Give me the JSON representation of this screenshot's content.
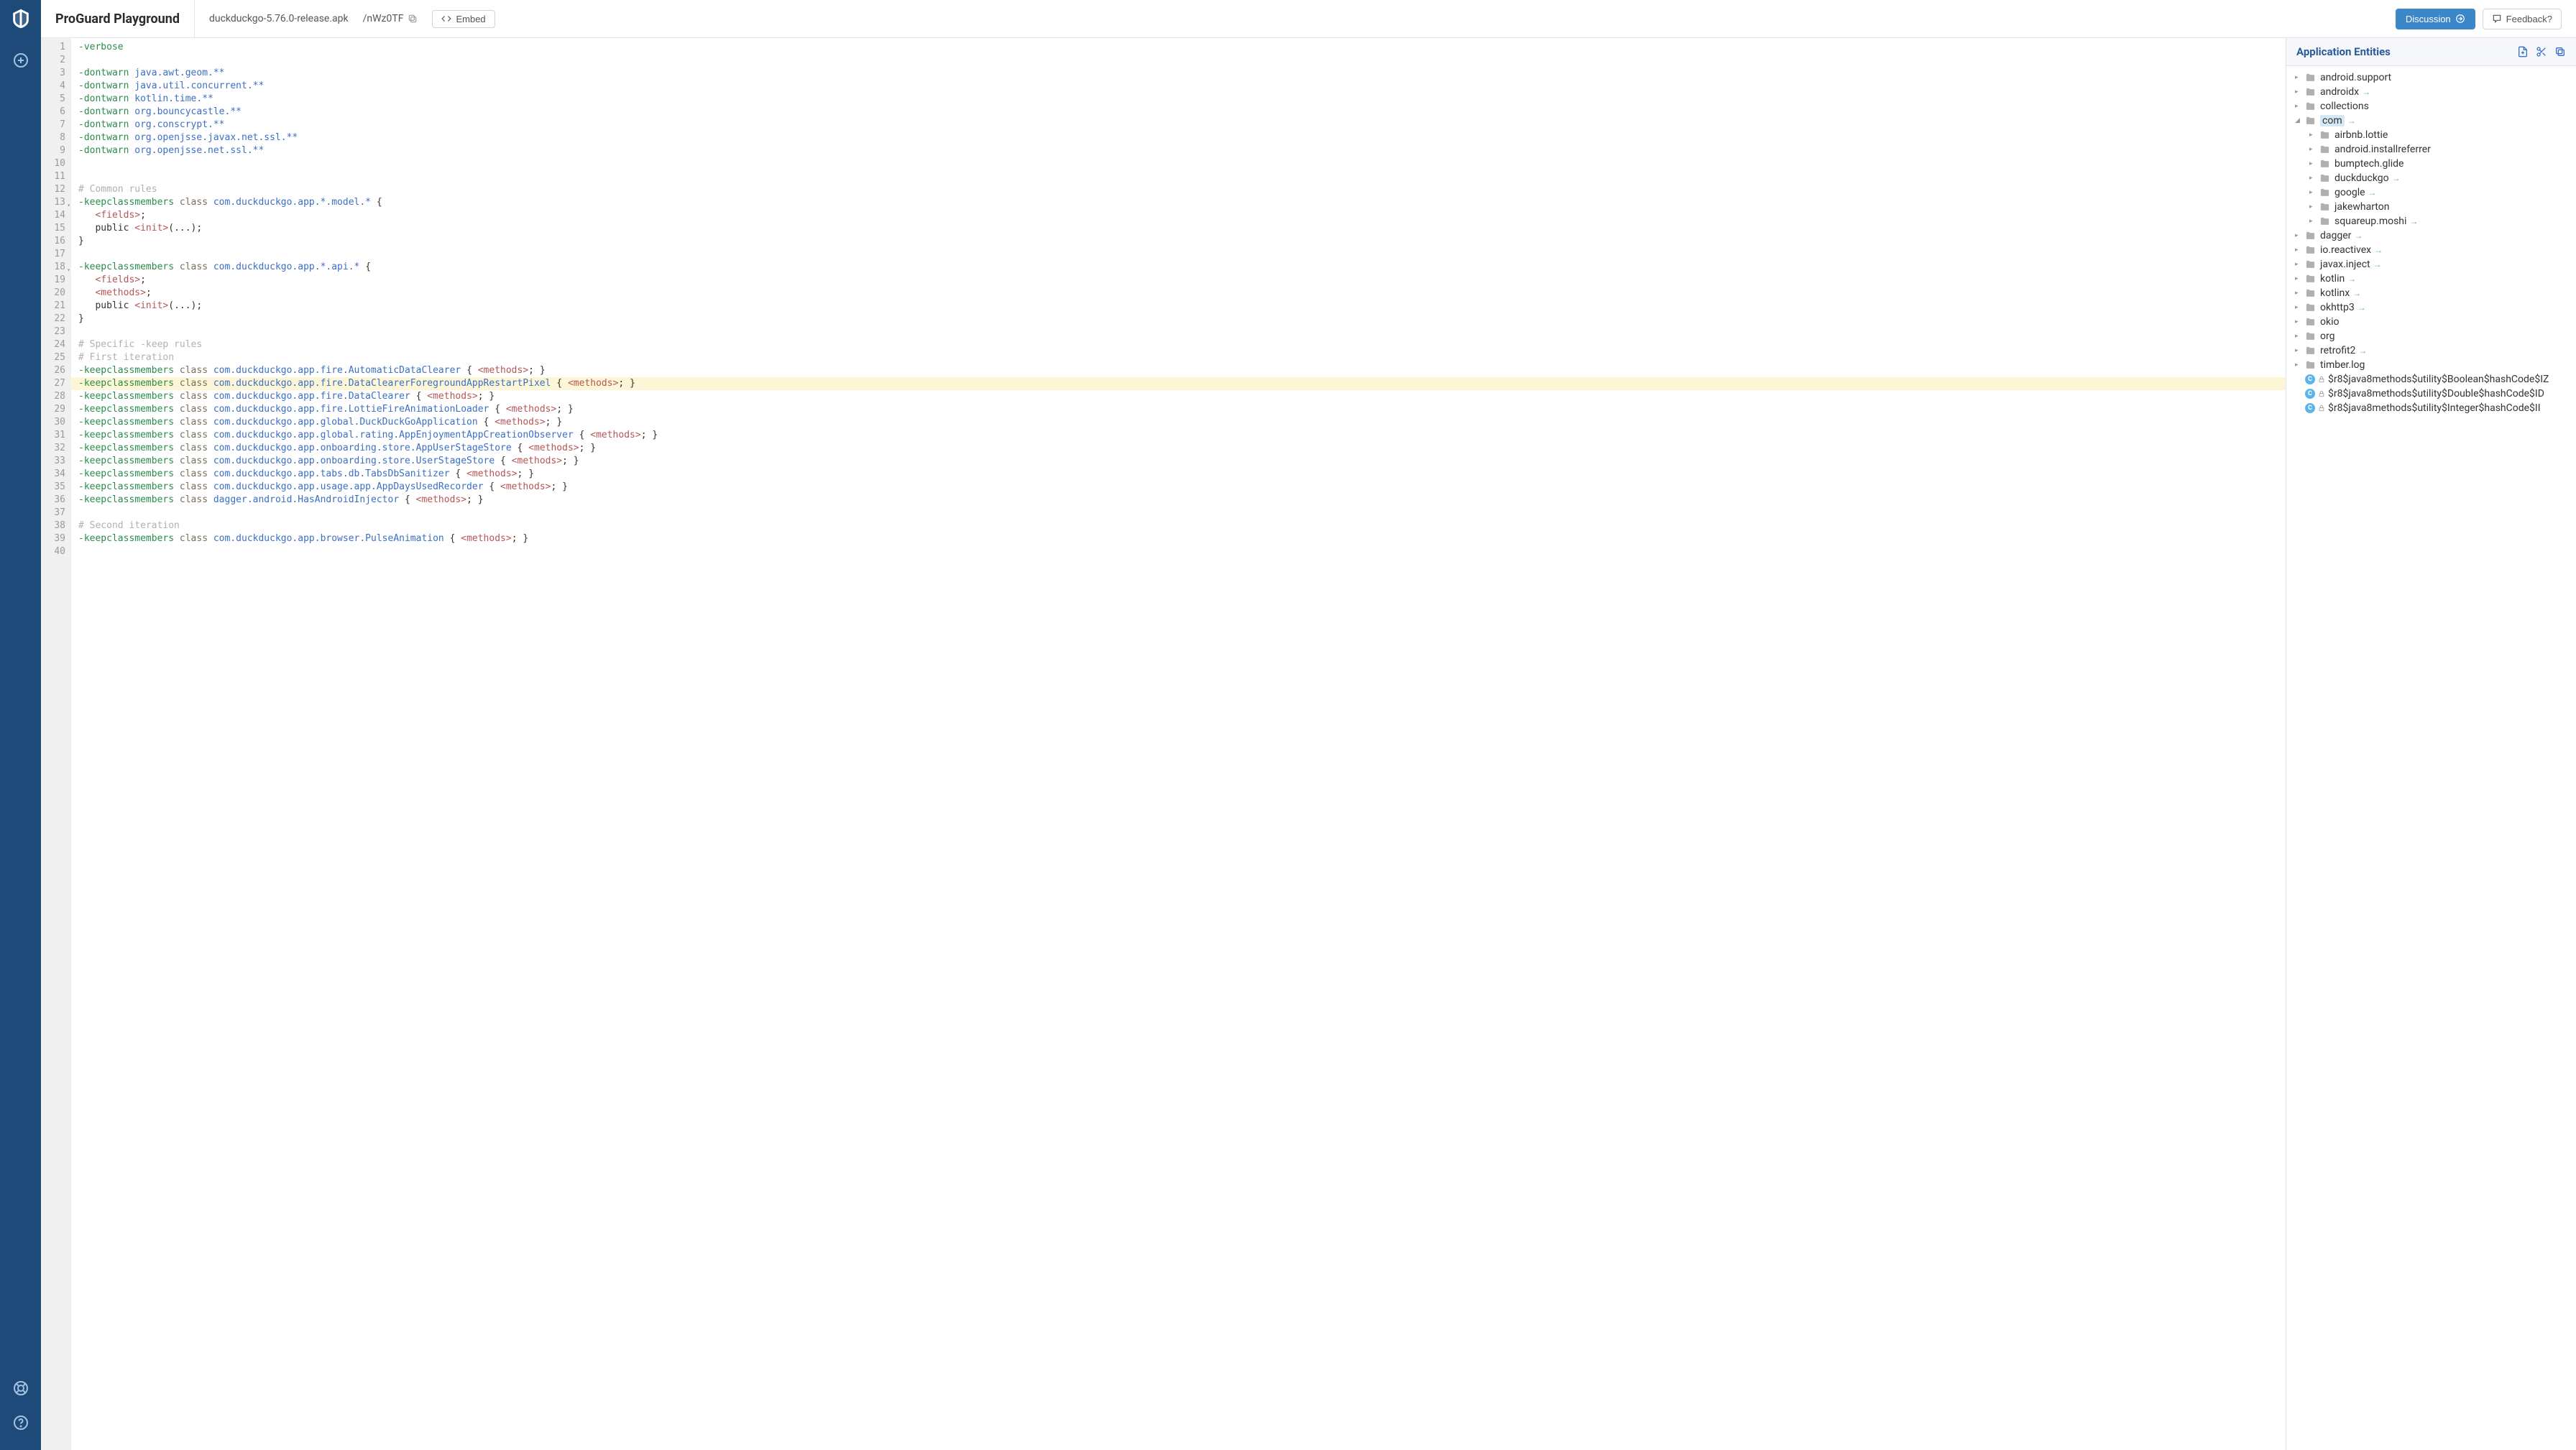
{
  "header": {
    "title": "ProGuard Playground",
    "filename": "duckduckgo-5.76.0-release.apk",
    "token": "/nWz0TF",
    "embed": "Embed",
    "discussion": "Discussion",
    "feedback": "Feedback?"
  },
  "entities": {
    "title": "Application Entities",
    "tree": [
      {
        "label": "android.support",
        "depth": 0,
        "type": "folder",
        "expanded": false
      },
      {
        "label": "androidx",
        "depth": 0,
        "type": "folder",
        "expanded": false,
        "arrow": true
      },
      {
        "label": "collections",
        "depth": 0,
        "type": "folder",
        "expanded": false
      },
      {
        "label": "com",
        "depth": 0,
        "type": "folder",
        "expanded": true,
        "arrow": true,
        "selected": true
      },
      {
        "label": "airbnb.lottie",
        "depth": 1,
        "type": "folder",
        "expanded": false
      },
      {
        "label": "android.installreferrer",
        "depth": 1,
        "type": "folder",
        "expanded": false
      },
      {
        "label": "bumptech.glide",
        "depth": 1,
        "type": "folder",
        "expanded": false
      },
      {
        "label": "duckduckgo",
        "depth": 1,
        "type": "folder",
        "expanded": false,
        "arrow": true
      },
      {
        "label": "google",
        "depth": 1,
        "type": "folder",
        "expanded": false,
        "arrow": true
      },
      {
        "label": "jakewharton",
        "depth": 1,
        "type": "folder",
        "expanded": false
      },
      {
        "label": "squareup.moshi",
        "depth": 1,
        "type": "folder",
        "expanded": false,
        "arrow": true
      },
      {
        "label": "dagger",
        "depth": 0,
        "type": "folder",
        "expanded": false,
        "arrow": true
      },
      {
        "label": "io.reactivex",
        "depth": 0,
        "type": "folder",
        "expanded": false,
        "arrow": true
      },
      {
        "label": "javax.inject",
        "depth": 0,
        "type": "folder",
        "expanded": false,
        "arrow": true
      },
      {
        "label": "kotlin",
        "depth": 0,
        "type": "folder",
        "expanded": false,
        "arrow": true
      },
      {
        "label": "kotlinx",
        "depth": 0,
        "type": "folder",
        "expanded": false,
        "arrow": true
      },
      {
        "label": "okhttp3",
        "depth": 0,
        "type": "folder",
        "expanded": false,
        "arrow": true
      },
      {
        "label": "okio",
        "depth": 0,
        "type": "folder",
        "expanded": false
      },
      {
        "label": "org",
        "depth": 0,
        "type": "folder",
        "expanded": false
      },
      {
        "label": "retrofit2",
        "depth": 0,
        "type": "folder",
        "expanded": false,
        "arrow": true
      },
      {
        "label": "timber.log",
        "depth": 0,
        "type": "folder",
        "expanded": false
      },
      {
        "label": "$r8$java8methods$utility$Boolean$hashCode$IZ",
        "depth": 0,
        "type": "class"
      },
      {
        "label": "$r8$java8methods$utility$Double$hashCode$ID",
        "depth": 0,
        "type": "class"
      },
      {
        "label": "$r8$java8methods$utility$Integer$hashCode$II",
        "depth": 0,
        "type": "class"
      }
    ]
  },
  "code": {
    "highlight_line": 27,
    "fold_lines": [
      13,
      18
    ],
    "lines": [
      {
        "n": 1,
        "tokens": [
          {
            "t": "-verbose",
            "c": "tok-green"
          }
        ]
      },
      {
        "n": 2,
        "tokens": []
      },
      {
        "n": 3,
        "tokens": [
          {
            "t": "-dontwarn",
            "c": "tok-green"
          },
          {
            "t": " "
          },
          {
            "t": "java.awt.geom.**",
            "c": "tok-blue"
          }
        ]
      },
      {
        "n": 4,
        "tokens": [
          {
            "t": "-dontwarn",
            "c": "tok-green"
          },
          {
            "t": " "
          },
          {
            "t": "java.util.concurrent.**",
            "c": "tok-blue"
          }
        ]
      },
      {
        "n": 5,
        "tokens": [
          {
            "t": "-dontwarn",
            "c": "tok-green"
          },
          {
            "t": " "
          },
          {
            "t": "kotlin.time.**",
            "c": "tok-blue"
          }
        ]
      },
      {
        "n": 6,
        "tokens": [
          {
            "t": "-dontwarn",
            "c": "tok-green"
          },
          {
            "t": " "
          },
          {
            "t": "org.bouncycastle.**",
            "c": "tok-blue"
          }
        ]
      },
      {
        "n": 7,
        "tokens": [
          {
            "t": "-dontwarn",
            "c": "tok-green"
          },
          {
            "t": " "
          },
          {
            "t": "org.conscrypt.**",
            "c": "tok-blue"
          }
        ]
      },
      {
        "n": 8,
        "tokens": [
          {
            "t": "-dontwarn",
            "c": "tok-green"
          },
          {
            "t": " "
          },
          {
            "t": "org.openjsse.javax.net.ssl.**",
            "c": "tok-blue"
          }
        ]
      },
      {
        "n": 9,
        "tokens": [
          {
            "t": "-dontwarn",
            "c": "tok-green"
          },
          {
            "t": " "
          },
          {
            "t": "org.openjsse.net.ssl.**",
            "c": "tok-blue"
          }
        ]
      },
      {
        "n": 10,
        "tokens": []
      },
      {
        "n": 11,
        "tokens": []
      },
      {
        "n": 12,
        "tokens": [
          {
            "t": "# Common rules",
            "c": "tok-comment"
          }
        ]
      },
      {
        "n": 13,
        "tokens": [
          {
            "t": "-keepclassmembers",
            "c": "tok-green"
          },
          {
            "t": " "
          },
          {
            "t": "class",
            "c": "tok-class"
          },
          {
            "t": " "
          },
          {
            "t": "com.duckduckgo.app.*.model.*",
            "c": "tok-blue"
          },
          {
            "t": " "
          },
          {
            "t": "{",
            "c": "tok-brace"
          }
        ]
      },
      {
        "n": 14,
        "tokens": [
          {
            "t": "   "
          },
          {
            "t": "<fields>",
            "c": "tok-red"
          },
          {
            "t": ";"
          }
        ]
      },
      {
        "n": 15,
        "tokens": [
          {
            "t": "   public "
          },
          {
            "t": "<init>",
            "c": "tok-red"
          },
          {
            "t": "(...);"
          }
        ]
      },
      {
        "n": 16,
        "tokens": [
          {
            "t": "}",
            "c": "tok-brace"
          }
        ]
      },
      {
        "n": 17,
        "tokens": []
      },
      {
        "n": 18,
        "tokens": [
          {
            "t": "-keepclassmembers",
            "c": "tok-green"
          },
          {
            "t": " "
          },
          {
            "t": "class",
            "c": "tok-class"
          },
          {
            "t": " "
          },
          {
            "t": "com.duckduckgo.app.*.api.*",
            "c": "tok-blue"
          },
          {
            "t": " "
          },
          {
            "t": "{",
            "c": "tok-brace"
          }
        ]
      },
      {
        "n": 19,
        "tokens": [
          {
            "t": "   "
          },
          {
            "t": "<fields>",
            "c": "tok-red"
          },
          {
            "t": ";"
          }
        ]
      },
      {
        "n": 20,
        "tokens": [
          {
            "t": "   "
          },
          {
            "t": "<methods>",
            "c": "tok-red"
          },
          {
            "t": ";"
          }
        ]
      },
      {
        "n": 21,
        "tokens": [
          {
            "t": "   public "
          },
          {
            "t": "<init>",
            "c": "tok-red"
          },
          {
            "t": "(...);"
          }
        ]
      },
      {
        "n": 22,
        "tokens": [
          {
            "t": "}",
            "c": "tok-brace"
          }
        ]
      },
      {
        "n": 23,
        "tokens": []
      },
      {
        "n": 24,
        "tokens": [
          {
            "t": "# Specific -keep rules",
            "c": "tok-comment"
          }
        ]
      },
      {
        "n": 25,
        "tokens": [
          {
            "t": "# First iteration",
            "c": "tok-comment"
          }
        ]
      },
      {
        "n": 26,
        "tokens": [
          {
            "t": "-keepclassmembers",
            "c": "tok-green"
          },
          {
            "t": " "
          },
          {
            "t": "class",
            "c": "tok-class"
          },
          {
            "t": " "
          },
          {
            "t": "com.duckduckgo.app.fire.AutomaticDataClearer",
            "c": "tok-blue"
          },
          {
            "t": " "
          },
          {
            "t": "{",
            "c": "tok-brace"
          },
          {
            "t": " "
          },
          {
            "t": "<methods>",
            "c": "tok-red"
          },
          {
            "t": "; "
          },
          {
            "t": "}",
            "c": "tok-brace"
          }
        ]
      },
      {
        "n": 27,
        "tokens": [
          {
            "t": "-keepclassmembers",
            "c": "tok-green"
          },
          {
            "t": " "
          },
          {
            "t": "class",
            "c": "tok-class"
          },
          {
            "t": " "
          },
          {
            "t": "com.duckduckgo.app.fire.DataClearerForegroundAppRestartPixel",
            "c": "tok-blue"
          },
          {
            "t": " "
          },
          {
            "t": "{",
            "c": "tok-brace"
          },
          {
            "t": " "
          },
          {
            "t": "<methods>",
            "c": "tok-red"
          },
          {
            "t": "; "
          },
          {
            "t": "}",
            "c": "tok-brace"
          }
        ]
      },
      {
        "n": 28,
        "tokens": [
          {
            "t": "-keepclassmembers",
            "c": "tok-green"
          },
          {
            "t": " "
          },
          {
            "t": "class",
            "c": "tok-class"
          },
          {
            "t": " "
          },
          {
            "t": "com.duckduckgo.app.fire.DataClearer",
            "c": "tok-blue"
          },
          {
            "t": " "
          },
          {
            "t": "{",
            "c": "tok-brace"
          },
          {
            "t": " "
          },
          {
            "t": "<methods>",
            "c": "tok-red"
          },
          {
            "t": "; "
          },
          {
            "t": "}",
            "c": "tok-brace"
          }
        ]
      },
      {
        "n": 29,
        "tokens": [
          {
            "t": "-keepclassmembers",
            "c": "tok-green"
          },
          {
            "t": " "
          },
          {
            "t": "class",
            "c": "tok-class"
          },
          {
            "t": " "
          },
          {
            "t": "com.duckduckgo.app.fire.LottieFireAnimationLoader",
            "c": "tok-blue"
          },
          {
            "t": " "
          },
          {
            "t": "{",
            "c": "tok-brace"
          },
          {
            "t": " "
          },
          {
            "t": "<methods>",
            "c": "tok-red"
          },
          {
            "t": "; "
          },
          {
            "t": "}",
            "c": "tok-brace"
          }
        ]
      },
      {
        "n": 30,
        "tokens": [
          {
            "t": "-keepclassmembers",
            "c": "tok-green"
          },
          {
            "t": " "
          },
          {
            "t": "class",
            "c": "tok-class"
          },
          {
            "t": " "
          },
          {
            "t": "com.duckduckgo.app.global.DuckDuckGoApplication",
            "c": "tok-blue"
          },
          {
            "t": " "
          },
          {
            "t": "{",
            "c": "tok-brace"
          },
          {
            "t": " "
          },
          {
            "t": "<methods>",
            "c": "tok-red"
          },
          {
            "t": "; "
          },
          {
            "t": "}",
            "c": "tok-brace"
          }
        ]
      },
      {
        "n": 31,
        "tokens": [
          {
            "t": "-keepclassmembers",
            "c": "tok-green"
          },
          {
            "t": " "
          },
          {
            "t": "class",
            "c": "tok-class"
          },
          {
            "t": " "
          },
          {
            "t": "com.duckduckgo.app.global.rating.AppEnjoymentAppCreationObserver",
            "c": "tok-blue"
          },
          {
            "t": " "
          },
          {
            "t": "{",
            "c": "tok-brace"
          },
          {
            "t": " "
          },
          {
            "t": "<methods>",
            "c": "tok-red"
          },
          {
            "t": "; "
          },
          {
            "t": "}",
            "c": "tok-brace"
          }
        ]
      },
      {
        "n": 32,
        "tokens": [
          {
            "t": "-keepclassmembers",
            "c": "tok-green"
          },
          {
            "t": " "
          },
          {
            "t": "class",
            "c": "tok-class"
          },
          {
            "t": " "
          },
          {
            "t": "com.duckduckgo.app.onboarding.store.AppUserStageStore",
            "c": "tok-blue"
          },
          {
            "t": " "
          },
          {
            "t": "{",
            "c": "tok-brace"
          },
          {
            "t": " "
          },
          {
            "t": "<methods>",
            "c": "tok-red"
          },
          {
            "t": "; "
          },
          {
            "t": "}",
            "c": "tok-brace"
          }
        ]
      },
      {
        "n": 33,
        "tokens": [
          {
            "t": "-keepclassmembers",
            "c": "tok-green"
          },
          {
            "t": " "
          },
          {
            "t": "class",
            "c": "tok-class"
          },
          {
            "t": " "
          },
          {
            "t": "com.duckduckgo.app.onboarding.store.UserStageStore",
            "c": "tok-blue"
          },
          {
            "t": " "
          },
          {
            "t": "{",
            "c": "tok-brace"
          },
          {
            "t": " "
          },
          {
            "t": "<methods>",
            "c": "tok-red"
          },
          {
            "t": "; "
          },
          {
            "t": "}",
            "c": "tok-brace"
          }
        ]
      },
      {
        "n": 34,
        "tokens": [
          {
            "t": "-keepclassmembers",
            "c": "tok-green"
          },
          {
            "t": " "
          },
          {
            "t": "class",
            "c": "tok-class"
          },
          {
            "t": " "
          },
          {
            "t": "com.duckduckgo.app.tabs.db.TabsDbSanitizer",
            "c": "tok-blue"
          },
          {
            "t": " "
          },
          {
            "t": "{",
            "c": "tok-brace"
          },
          {
            "t": " "
          },
          {
            "t": "<methods>",
            "c": "tok-red"
          },
          {
            "t": "; "
          },
          {
            "t": "}",
            "c": "tok-brace"
          }
        ]
      },
      {
        "n": 35,
        "tokens": [
          {
            "t": "-keepclassmembers",
            "c": "tok-green"
          },
          {
            "t": " "
          },
          {
            "t": "class",
            "c": "tok-class"
          },
          {
            "t": " "
          },
          {
            "t": "com.duckduckgo.app.usage.app.AppDaysUsedRecorder",
            "c": "tok-blue"
          },
          {
            "t": " "
          },
          {
            "t": "{",
            "c": "tok-brace"
          },
          {
            "t": " "
          },
          {
            "t": "<methods>",
            "c": "tok-red"
          },
          {
            "t": "; "
          },
          {
            "t": "}",
            "c": "tok-brace"
          }
        ]
      },
      {
        "n": 36,
        "tokens": [
          {
            "t": "-keepclassmembers",
            "c": "tok-green"
          },
          {
            "t": " "
          },
          {
            "t": "class",
            "c": "tok-class"
          },
          {
            "t": " "
          },
          {
            "t": "dagger.android.HasAndroidInjector",
            "c": "tok-blue"
          },
          {
            "t": " "
          },
          {
            "t": "{",
            "c": "tok-brace"
          },
          {
            "t": " "
          },
          {
            "t": "<methods>",
            "c": "tok-red"
          },
          {
            "t": "; "
          },
          {
            "t": "}",
            "c": "tok-brace"
          }
        ]
      },
      {
        "n": 37,
        "tokens": []
      },
      {
        "n": 38,
        "tokens": [
          {
            "t": "# Second iteration",
            "c": "tok-comment"
          }
        ]
      },
      {
        "n": 39,
        "tokens": [
          {
            "t": "-keepclassmembers",
            "c": "tok-green"
          },
          {
            "t": " "
          },
          {
            "t": "class",
            "c": "tok-class"
          },
          {
            "t": " "
          },
          {
            "t": "com.duckduckgo.app.browser.PulseAnimation",
            "c": "tok-blue"
          },
          {
            "t": " "
          },
          {
            "t": "{",
            "c": "tok-brace"
          },
          {
            "t": " "
          },
          {
            "t": "<methods>",
            "c": "tok-red"
          },
          {
            "t": "; "
          },
          {
            "t": "}",
            "c": "tok-brace"
          }
        ]
      },
      {
        "n": 40,
        "tokens": []
      }
    ]
  }
}
